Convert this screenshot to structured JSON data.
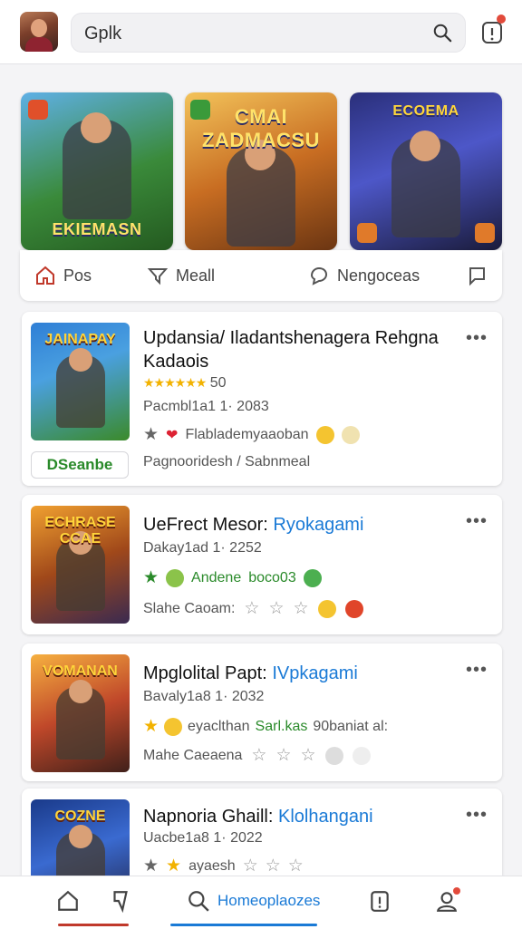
{
  "search": {
    "value": "Gplk"
  },
  "carousel": {
    "banners": [
      {
        "title": "EKIEMASN"
      },
      {
        "title": "CMAI ZADMACSU"
      },
      {
        "title": "ECOEMA"
      }
    ],
    "tabs": [
      {
        "label": "Pos",
        "icon": "home-icon"
      },
      {
        "label": "Meall",
        "icon": "chat-icon"
      },
      {
        "label": "Nengoceas",
        "icon": "chat-bubble-icon"
      },
      {
        "label": "",
        "icon": "comment-icon"
      }
    ]
  },
  "cards": [
    {
      "thumb_title": "JAINAPAY",
      "title": "Updansia/ Iladantshenagera Rehgna Kadaois",
      "rating_count": "50",
      "date": "Pacmbl1a1 1· 2083",
      "tag": "Flablademyaaoban",
      "button": "DSeanbe",
      "footer": "Pagnooridesh / Sabnmeal"
    },
    {
      "thumb_title": "ECHRASE CCAE",
      "title_main": "UeFrect Mesor:",
      "title_hl": "Ryokagami",
      "date": "Dakay1ad 1· 2252",
      "tag_a": "Andene",
      "tag_b": "boco03",
      "status": "Slahe Caoam:"
    },
    {
      "thumb_title": "VOMANAN",
      "title_main": "Mpglolital Papt:",
      "title_hl": "IVpkagami",
      "date": "Bavaly1a8 1· 2032",
      "tag": "eyaclthan",
      "tag_extra": "Sarl.kas",
      "tag_tail": "90baniat al:",
      "status": "Mahe Caeaena"
    },
    {
      "thumb_title": "COZNE",
      "title_main": "Napnoria Ghaill:",
      "title_hl": "Klolhangani",
      "date": "Uacbe1a8 1· 2022",
      "tag": "ayaesh"
    }
  ],
  "bottom_nav": [
    {
      "label": "",
      "icon": "home-icon"
    },
    {
      "label": "",
      "icon": "bookmark-icon"
    },
    {
      "label": "Homeoplaozes",
      "icon": "search-icon"
    },
    {
      "label": "",
      "icon": "notification-icon"
    },
    {
      "label": "",
      "icon": "profile-icon"
    }
  ],
  "colors": {
    "accent": "#1a7ad6",
    "badge": "#e24a3b",
    "star": "#f2b200",
    "green": "#2a8a2a",
    "nav_home_indicator": "#c0392b"
  }
}
